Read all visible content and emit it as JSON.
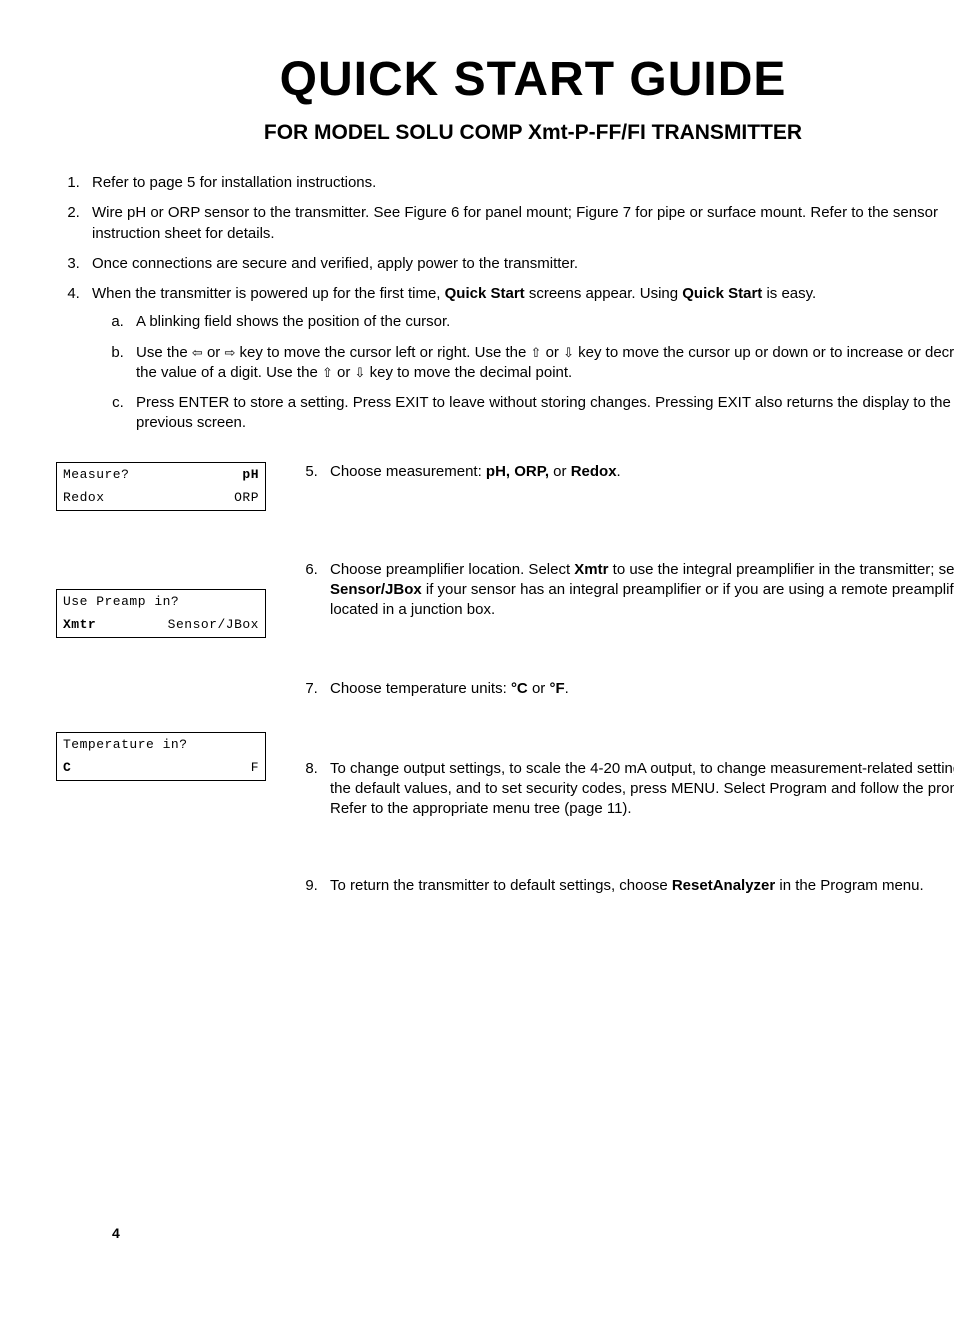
{
  "title": "QUICK START GUIDE",
  "subtitle": "FOR MODEL SOLU COMP Xmt-P-FF/FI TRANSMITTER",
  "mainList": {
    "i1": "Refer to page 5 for installation instructions.",
    "i2": "Wire pH or ORP sensor to the transmitter. See Figure 6 for panel mount; Figure 7 for pipe or surface mount. Refer to the sensor instruction sheet for details.",
    "i3": "Once connections are secure and verified, apply power to the transmitter.",
    "i4_a": "When the transmitter is powered up for the first time, ",
    "i4_b": "Quick Start",
    "i4_c": " screens appear. Using ",
    "i4_d": "Quick Start",
    "i4_e": " is easy.",
    "sub": {
      "a": "A blinking field shows the position of the cursor.",
      "b1": "Use the ",
      "b_left": "⇦",
      "b2": " or ",
      "b_right": "⇨",
      "b3": " key to move the cursor left or right. Use the ",
      "b_up": "⇧",
      "b4": " or  ",
      "b_down": "⇩",
      "b5": " key to move the cursor up or down or to increase or decrease the value of a digit. Use the ",
      "b_up2": "⇧",
      "b6": " or  ",
      "b_down2": "⇩",
      "b7": " key to move the decimal point.",
      "c": "Press ENTER to store a setting. Press EXIT to leave without storing changes. Pressing EXIT also returns the display to the previous screen."
    }
  },
  "lcd1": {
    "r1l": "Measure?",
    "r1r": "pH",
    "r2l": "Redox",
    "r2r": "ORP"
  },
  "lcd2": {
    "r1l": "Use Preamp in?",
    "r1r": "",
    "r2l": "Xmtr",
    "r2r": "Sensor/JBox"
  },
  "lcd3": {
    "r1l": "Temperature in?",
    "r1r": "",
    "r2l": "C",
    "r2r": "F"
  },
  "rightList": {
    "s5_a": "Choose measurement: ",
    "s5_b": "pH, ORP,",
    "s5_c": " or ",
    "s5_d": "Redox",
    "s5_e": ".",
    "s6_a": "Choose preamplifier location. Select ",
    "s6_b": "Xmtr",
    "s6_c": " to use the integral preamplifier in the transmitter; select ",
    "s6_d": "Sensor/JBox",
    "s6_e": " if your sensor has an integral preamplifier or if you are using a remote preamplifier located in a junction box.",
    "s7_a": "Choose temperature units: ",
    "s7_b": "°C",
    "s7_c": " or ",
    "s7_d": "°F",
    "s7_e": ".",
    "s8": "To change output settings, to scale the 4-20 mA output, to change measurement-related settings from the default values, and to set security codes, press MENU. Select Program and follow the prompts. Refer to the appropriate menu tree (page 11).",
    "s9_a": "To return the transmitter to default settings, choose ",
    "s9_b": "ResetAnalyzer",
    "s9_c": " in the Program menu."
  },
  "pageNumber": "4"
}
